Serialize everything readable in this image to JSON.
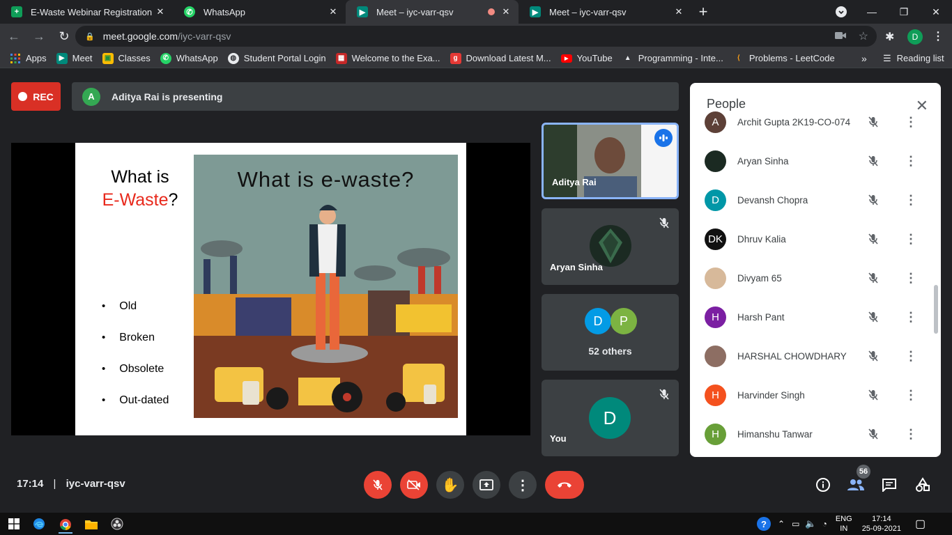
{
  "browser": {
    "tabs": [
      {
        "title": "E-Waste Webinar Registration (e",
        "icon": "sheets-icon",
        "color": "#0f9d58"
      },
      {
        "title": "WhatsApp",
        "icon": "whatsapp-icon",
        "color": "#25d366"
      },
      {
        "title": "Meet – iyc-varr-qsv",
        "icon": "meet-icon",
        "color": "#00897b",
        "active": true,
        "recording": true
      },
      {
        "title": "Meet – iyc-varr-qsv",
        "icon": "meet-icon",
        "color": "#00897b"
      }
    ],
    "url_host": "meet.google.com",
    "url_path": "/iyc-varr-qsv",
    "profile_initial": "D",
    "bookmarks": [
      {
        "label": "Apps",
        "icon": "apps-grid-icon"
      },
      {
        "label": "Meet",
        "icon": "meet-icon"
      },
      {
        "label": "Classes",
        "icon": "classroom-icon"
      },
      {
        "label": "WhatsApp",
        "icon": "whatsapp-icon"
      },
      {
        "label": "Student Portal Login",
        "icon": "globe-icon"
      },
      {
        "label": "Welcome to the Exa...",
        "icon": "site-icon"
      },
      {
        "label": "Download Latest M...",
        "icon": "g-icon"
      },
      {
        "label": "YouTube",
        "icon": "youtube-icon"
      },
      {
        "label": "Programming - Inte...",
        "icon": "mountain-icon"
      },
      {
        "label": "Problems - LeetCode",
        "icon": "leetcode-icon"
      }
    ],
    "bookmarks_more": "»",
    "reading_list": "Reading list"
  },
  "meet": {
    "rec_label": "REC",
    "presenter_initial": "A",
    "presenting_text": "Aditya Rai is presenting",
    "slide": {
      "title_line1": "What is",
      "title_red": "E-Waste",
      "title_q": "?",
      "bullets": [
        "Old",
        "Broken",
        "Obsolete",
        "Out-dated"
      ],
      "image_title": "What is e-waste?"
    },
    "tiles": [
      {
        "name": "Aditya Rai"
      },
      {
        "name": "Aryan Sinha"
      },
      {
        "name": "52 others",
        "avatars": [
          "D",
          "P"
        ]
      },
      {
        "name": "You",
        "avatar": "D"
      }
    ],
    "people": {
      "title": "People",
      "list": [
        {
          "initials": "A",
          "name": "Archit Gupta 2K19-CO-074",
          "color": "#5d4037"
        },
        {
          "initials": "",
          "name": "Aryan Sinha",
          "color": "#1b2a22"
        },
        {
          "initials": "D",
          "name": "Devansh Chopra",
          "color": "#0097a7"
        },
        {
          "initials": "DK",
          "name": "Dhruv Kalia",
          "color": "#111111"
        },
        {
          "initials": "",
          "name": "Divyam 65",
          "color": "#d7b99a"
        },
        {
          "initials": "H",
          "name": "Harsh Pant",
          "color": "#7b1fa2"
        },
        {
          "initials": "",
          "name": "HARSHAL CHOWDHARY",
          "color": "#8d6e63"
        },
        {
          "initials": "H",
          "name": "Harvinder Singh",
          "color": "#f4511e"
        },
        {
          "initials": "H",
          "name": "Himanshu Tanwar",
          "color": "#689f38"
        }
      ]
    },
    "time": "17:14",
    "separator": "|",
    "meeting_code": "iyc-varr-qsv",
    "participant_count": "56"
  },
  "taskbar": {
    "lang_line1": "ENG",
    "lang_line2": "IN",
    "time": "17:14",
    "date": "25-09-2021"
  }
}
